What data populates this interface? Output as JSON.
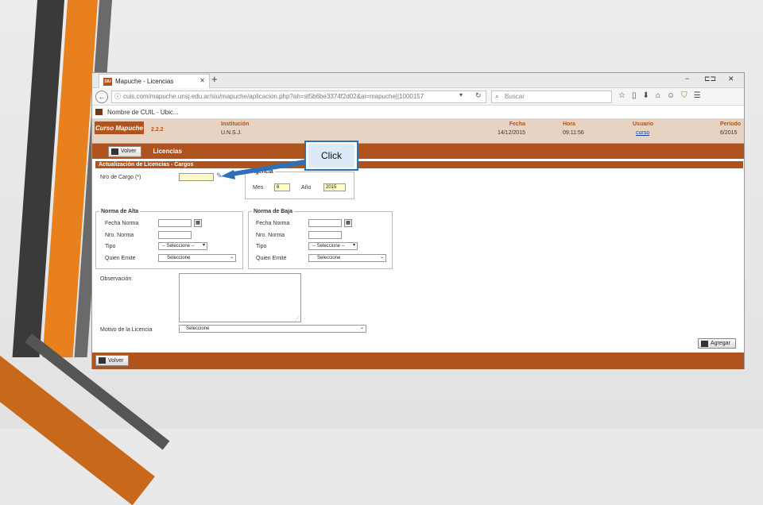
{
  "browser": {
    "tab_title": "Mapuche - Licencias",
    "favicon_text": "SIU",
    "tab_close": "✕",
    "new_tab": "+",
    "window_controls": [
      "−",
      "⊏⊐",
      "✕"
    ],
    "url": "cuis.com/mapuche.unsj.edu.ar/siu/mapuche/aplicacion.php?ah=st5b6be3374f2d02&ai=mapuche||1000157",
    "search_placeholder": "Buscar",
    "bookmark_label": "Nombre de CUIL - Ubic..."
  },
  "header": {
    "logo_text": "Curso Mapuche",
    "version": "2.2.2",
    "institucion_label": "Institución",
    "institucion_value": "U.N.S.J.",
    "fecha_label": "Fecha",
    "fecha_value": "14/12/2015",
    "hora_label": "Hora",
    "hora_value": "09:11:56",
    "usuario_label": "Usuario",
    "usuario_value": "curso",
    "periodo_label": "Período",
    "periodo_value": "6/2015"
  },
  "appbar": {
    "volver_label": "Volver",
    "title": "Licencias"
  },
  "form": {
    "section_title": "Actualización de Licencias - Cargos",
    "nro_cargo_label": "Nro de Cargo (*)",
    "vigencia_legend": "Vigencia",
    "mes_label": "Mes",
    "mes_value": "6",
    "anio_label": "Año",
    "anio_value": "2015",
    "alta_legend": "Norma de Alta",
    "baja_legend": "Norma de Baja",
    "fecha_norma_label": "Fecha Norma",
    "nro_norma_label": "Nro. Norma",
    "tipo_label": "Tipo",
    "quien_emite_label": "Quien Emite",
    "tipo_select": "-- Seleccione --",
    "quien_select": "Seleccione",
    "observacion_label": "Observación",
    "motivo_label": "Motivo de la Licencia",
    "motivo_select": "Seleccione",
    "agregar_label": "Agregar",
    "volver_bottom": "Volver"
  },
  "callout": {
    "text": "Click"
  }
}
